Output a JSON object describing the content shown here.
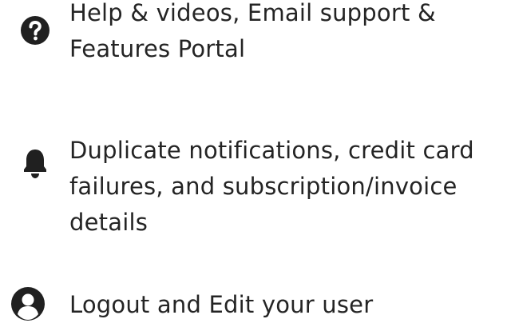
{
  "menu": {
    "items": [
      {
        "icon": "question-circle-icon",
        "label": "Help & videos, Email support & Features Portal"
      },
      {
        "icon": "bell-icon",
        "label": "Duplicate notifications, credit card failures, and subscription/invoice details"
      },
      {
        "icon": "user-circle-icon",
        "label": "Logout and Edit your user"
      }
    ]
  }
}
